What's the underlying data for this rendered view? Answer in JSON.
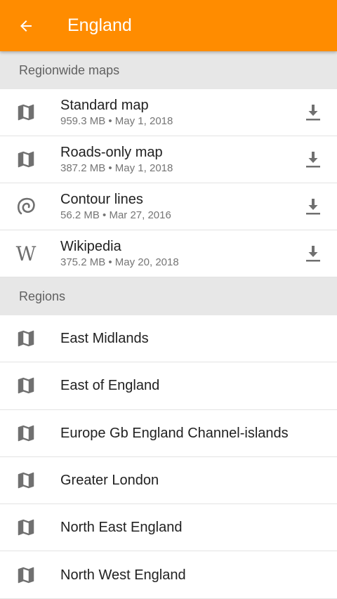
{
  "appbar": {
    "title": "England",
    "back_icon": "arrow-left-icon",
    "color": "#ff8c00"
  },
  "sections": {
    "regionwide": {
      "header": "Regionwide maps",
      "items": [
        {
          "title": "Standard map",
          "subtitle": "959.3 MB • May 1, 2018",
          "icon": "map-icon"
        },
        {
          "title": "Roads-only map",
          "subtitle": "387.2 MB • May 1, 2018",
          "icon": "map-icon"
        },
        {
          "title": "Contour lines",
          "subtitle": "56.2 MB • Mar 27, 2016",
          "icon": "contour-icon"
        },
        {
          "title": "Wikipedia",
          "subtitle": "375.2 MB • May 20, 2018",
          "icon": "wikipedia-icon",
          "glyph": "W"
        }
      ]
    },
    "regions": {
      "header": "Regions",
      "items": [
        {
          "title": "East Midlands"
        },
        {
          "title": "East of England"
        },
        {
          "title": "Europe Gb England Channel-islands"
        },
        {
          "title": "Greater London"
        },
        {
          "title": "North East England"
        },
        {
          "title": "North West England"
        }
      ]
    }
  }
}
